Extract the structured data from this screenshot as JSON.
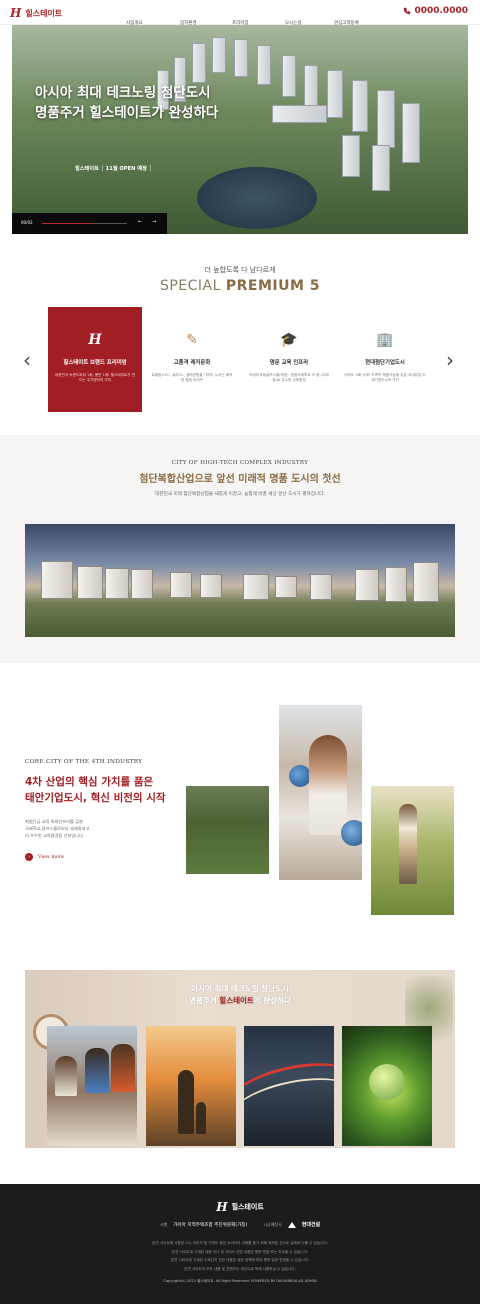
{
  "header": {
    "logo_mark": "H",
    "logo_text": "힐스테이트",
    "nav": [
      "사업개요",
      "입지환경",
      "프리미엄",
      "모시는길",
      "관심고객등록"
    ],
    "phone_icon": "phone-icon",
    "phone": "0000.0000"
  },
  "hero": {
    "title_line1": "아시아 최대 테크노링 첨단도시",
    "title_line2": "명품주거 힐스테이트가 완성하다",
    "sub": "힐스테이트 │ 11월 OPEN 예정 │",
    "counter": "00/03",
    "progress": 0.6,
    "prev": "←",
    "next": "→"
  },
  "premium": {
    "sub": "더 높합도록 다 남다르게",
    "title_light": "SPECIAL ",
    "title_bold": "PREMIUM 5",
    "prev_arrow": "‹",
    "next_arrow": "›",
    "cards": [
      {
        "icon": "H",
        "title": "힐스테이트 브랜드 프리미엄",
        "desc": "대한민국 브랜드파워 1위, 품번 1위! 힐스테이트가 만드는 주거명작의 가치"
      },
      {
        "icon": "✎",
        "title": "고품격 레저문화",
        "desc": "로얄링스CC, 솔라CC, 생태공원을 가까이 누리는 쾌적한 힐링 라이프"
      },
      {
        "icon": "🎓",
        "title": "명문 교육 인프라",
        "desc": "박세리국제골프스쿨(예정), 명품국제학교 초·중·고(예정)로 우수한 교육환경"
      },
      {
        "icon": "🏢",
        "title": "현대첨단기업도시",
        "desc": "여의도 5배 규모! 자족적 복합기능을 갖춘 국내유일 미래기업도시의 가치"
      }
    ]
  },
  "city": {
    "sub": "CITY OF HIGH-TECH COMPLEX INDUSTRY",
    "title": "첨단복합산업으로 앞선 미래적 명품 도시의 첫선",
    "desc": "대한민국 미래 첨단복합산업을 새롭게 이끌고, 높합게 바꿀 세상 앞선 도시가 펼쳐집니다."
  },
  "core": {
    "sub": "CORE CITY OF THE 4TH INDUSTRY",
    "title_line1": "4차 산업의 핵심 가치를 품은",
    "title_line2": "태안기업도시, 혁신 비전의 시작",
    "desc_lines": [
      "최첨단급 교육 특화인프라를 갖춘",
      "국제학교,골프스쿨로보다 세계화되고",
      "더 우수한 교육환경을 선보입니다"
    ],
    "more_icon": "arrow-right-icon",
    "more_label": "View more"
  },
  "band": {
    "line1_a": "아시아 최대 ",
    "line1_b": "테크노링 첨단도시",
    "line2_a": "명품주거 ",
    "line2_hl": "힐스테이트",
    "line2_b": "가 완성하다"
  },
  "footer": {
    "logo_mark": "H",
    "logo_text": "힐스테이트",
    "agency_label": "시행",
    "agency": "가이아 지역주택조합 추진위원회(가칭)",
    "builder_label": "시공예정사",
    "builder": "현대건설",
    "notes": [
      "본견 사이트에 사용된 CG, 이미지 및 지역도 등은 소비자의 이해를 돕기 위해 제작된 것으로 실제와 다를 수 있습니다.",
      "본견 사이트에 기재된 내용 이나 및 서비스 관련 내용은 향후 변경 또는 취소될 수 있습니다.",
      "본견 사이트에 기재된 주요단지 관련 내용은 상담 정책에 따라 향후 일부 변경될 수 있습니다.",
      "본견 사이트의 모든 내용 및 콘텐츠는 무단으로 복제 사용하실 수 없습니다."
    ],
    "copyright": "Copyright(c) 2022 힐스테이트. All Right Reserved. POWERED BY DASANREALAD ADMIN"
  }
}
